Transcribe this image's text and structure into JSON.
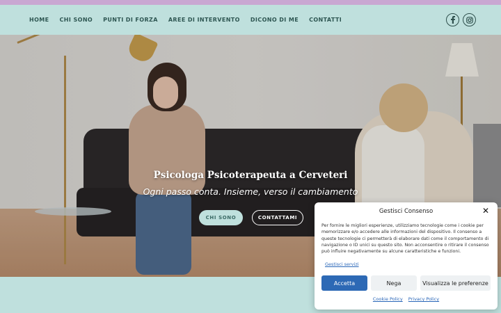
{
  "colors": {
    "accent": "#bfe0dd",
    "top_strip": "#c9a7d2",
    "nav_text": "#2e5652",
    "consent_primary": "#2d69b5"
  },
  "nav": {
    "items": [
      "HOME",
      "CHI SONO",
      "PUNTI DI FORZA",
      "AREE DI INTERVENTO",
      "DICONO DI ME",
      "CONTATTI"
    ]
  },
  "social": {
    "facebook_icon": "facebook-icon",
    "instagram_icon": "instagram-icon"
  },
  "hero": {
    "title": "Psicologa Psicoterapeuta a Cerveteri",
    "subtitle": "Ogni passo conta. Insieme, verso il cambiamento",
    "primary_button": "CHI SONO",
    "secondary_button": "CONTATTAMI"
  },
  "consent": {
    "title": "Gestisci Consenso",
    "text": "Per fornire le migliori esperienze, utilizziamo tecnologie come i cookie per memorizzare e/o accedere alle informazioni del dispositivo. Il consenso a queste tecnologie ci permetterà di elaborare dati come il comportamento di navigazione o ID unici su questo sito. Non acconsentire o ritirare il consenso può influire negativamente su alcune caratteristiche e funzioni.",
    "manage_link": "Gestisci servizi",
    "accept": "Accetta",
    "deny": "Nega",
    "preferences": "Visualizza le preferenze",
    "cookie_policy": "Cookie Policy",
    "privacy_policy": "Privacy Policy"
  }
}
